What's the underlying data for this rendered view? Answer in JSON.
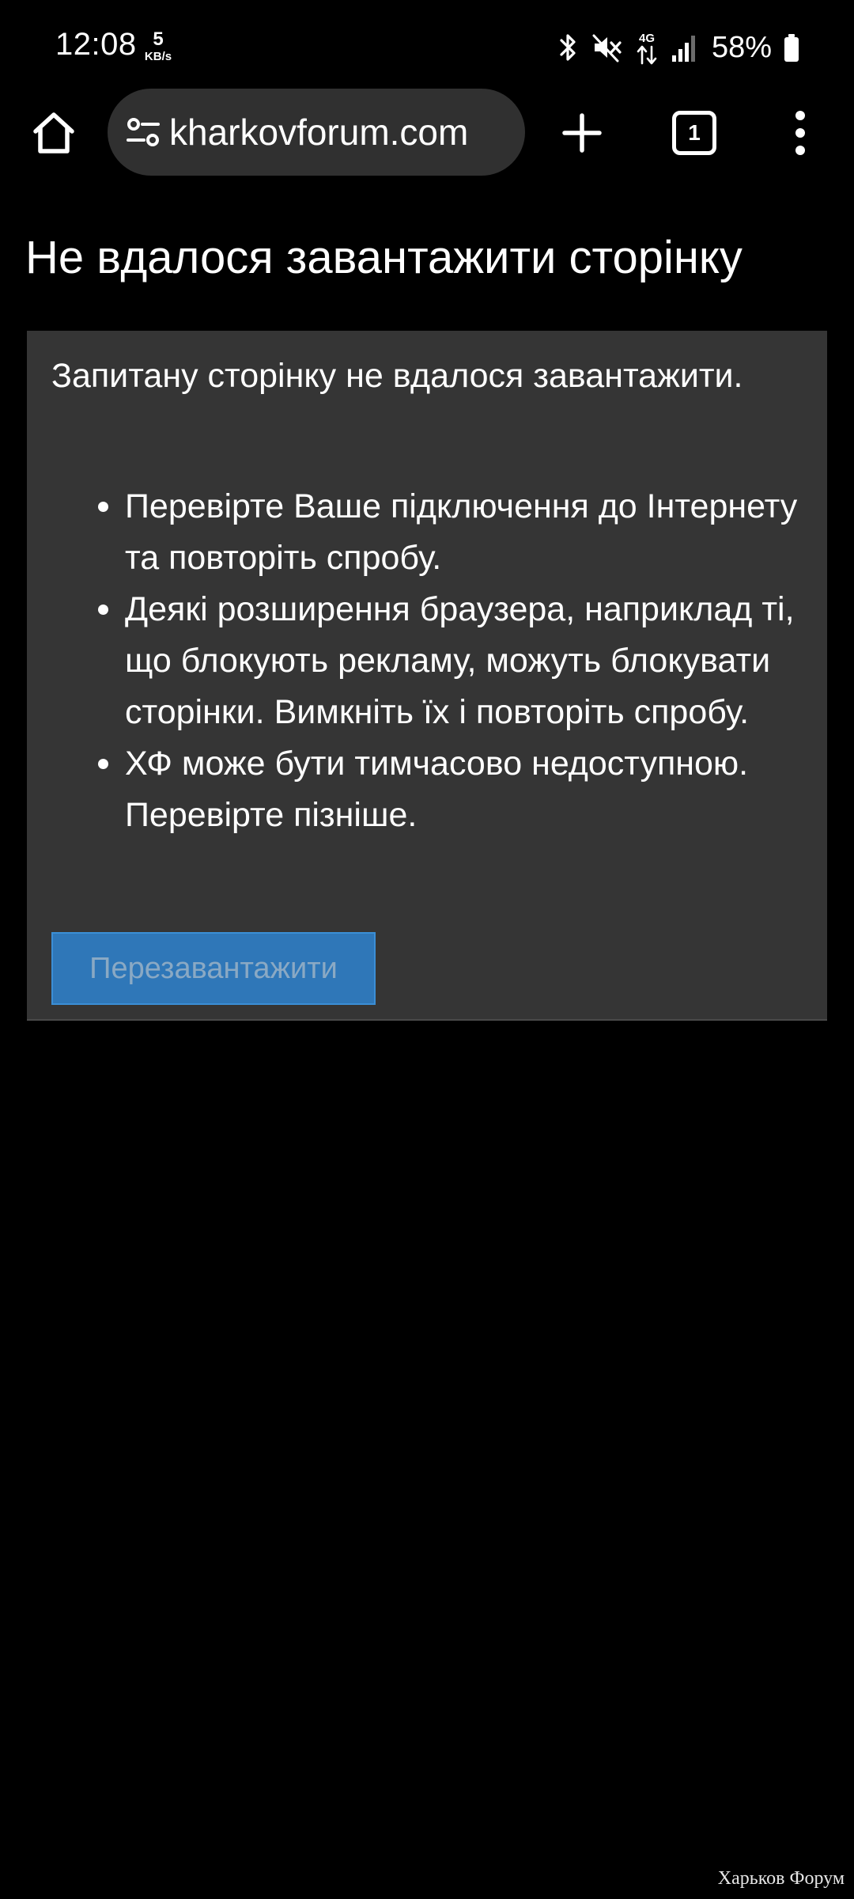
{
  "status_bar": {
    "time": "12:08",
    "net_speed_value": "5",
    "net_speed_unit": "KB/s",
    "network_type": "4G",
    "battery_percent": "58%",
    "icons": [
      "bluetooth-icon",
      "mute-icon",
      "4g-data-icon",
      "signal-icon",
      "battery-icon"
    ]
  },
  "browser": {
    "url": "kharkovforum.com",
    "tab_count": "1",
    "icons": {
      "home": "home-icon",
      "site_settings": "tune-icon",
      "new_tab": "plus-icon",
      "tabs": "tab-switcher-icon",
      "menu": "more-vert-icon"
    }
  },
  "page": {
    "title": "Не вдалося завантажити сторінку",
    "description": "Запитану сторінку не вдалося завантажити.",
    "tips": [
      "Перевірте Ваше підключення до Інтернету та повторіть спробу.",
      "Деякі розширення браузера, наприклад ті, що блокують рекламу, можуть блокувати сторінки. Вимкніть їх і повторіть спробу.",
      "ХФ може бути тимчасово недоступною. Перевірте пізніше."
    ],
    "reload_label": "Перезавантажити"
  },
  "watermark": "Харьков Форум",
  "colors": {
    "background": "#000000",
    "card": "#353535",
    "omnibox": "#303030",
    "button": "#2f77b8",
    "button_text": "#8aa9c4"
  }
}
